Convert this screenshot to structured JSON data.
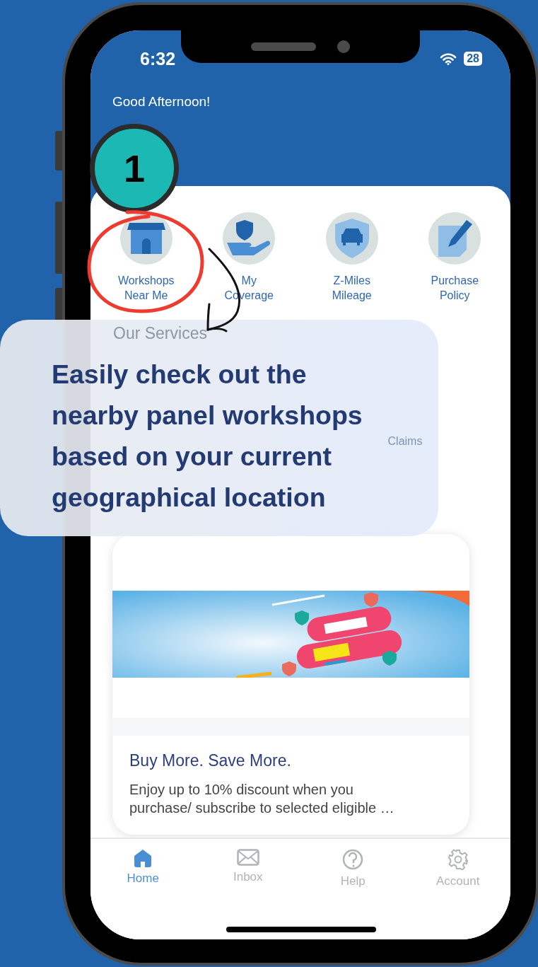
{
  "status_bar": {
    "time": "6:32",
    "battery": "28"
  },
  "greeting": "Good Afternoon!",
  "step_badge": "1",
  "quick_actions": [
    {
      "label": "Workshops\nNear Me",
      "kind": "workshop",
      "highlighted": true
    },
    {
      "label": "My\nCoverage",
      "kind": "coverage",
      "highlighted": false
    },
    {
      "label": "Z-Miles\nMileage",
      "kind": "car",
      "highlighted": false
    },
    {
      "label": "Purchase\nPolicy",
      "kind": "policy",
      "highlighted": false
    }
  ],
  "services_title": "Our Services",
  "services": [
    {
      "label": "Claims"
    }
  ],
  "news": {
    "title": "Buy More. Save More.",
    "description": "Enjoy up to 10% discount when you purchase/ subscribe to selected eligible …"
  },
  "callout": "Easily check out the nearby panel workshops based on your current geographical location",
  "tabs": [
    {
      "label": "Home",
      "kind": "home",
      "selected": true
    },
    {
      "label": "Inbox",
      "kind": "inbox",
      "selected": false
    },
    {
      "label": "Help",
      "kind": "help",
      "selected": false
    },
    {
      "label": "Account",
      "kind": "account",
      "selected": false
    }
  ]
}
